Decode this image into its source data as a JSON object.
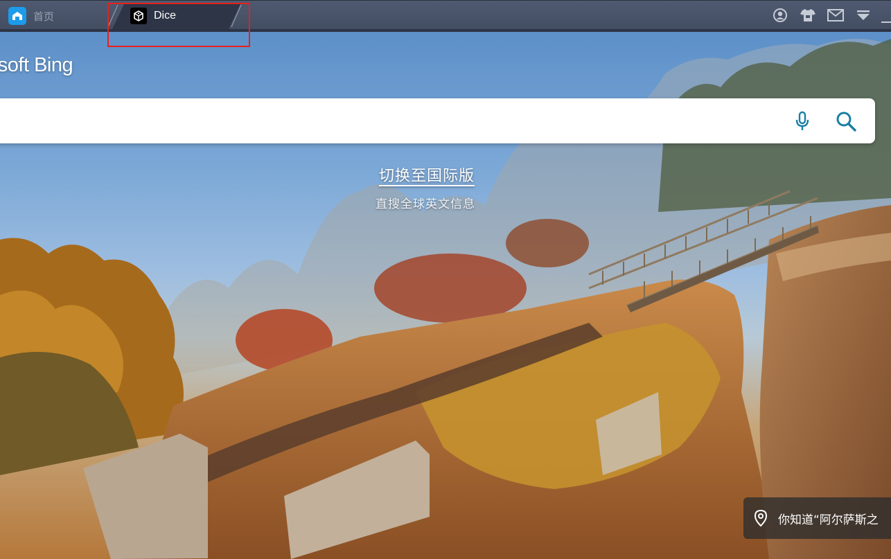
{
  "tabs": {
    "home_label": "首页",
    "active_label": "Dice"
  },
  "bing": {
    "logo_text": "rosoft Bing",
    "search_value": "",
    "switch_link": "切换至国际版",
    "switch_subtitle": "直搜全球英文信息",
    "info_card_text": "你知道“阿尔萨斯之"
  },
  "colors": {
    "tab_highlight": "#e8201c",
    "search_icon": "#1a7fa4",
    "home_icon_bg": "#1c9bea"
  },
  "icons": {
    "home": "home-icon",
    "dice": "dice-icon",
    "account": "account-icon",
    "skin": "shirt-icon",
    "mail": "mail-icon",
    "menu": "dropdown-icon",
    "mic": "microphone-icon",
    "search": "search-icon",
    "location": "location-pin-icon"
  }
}
